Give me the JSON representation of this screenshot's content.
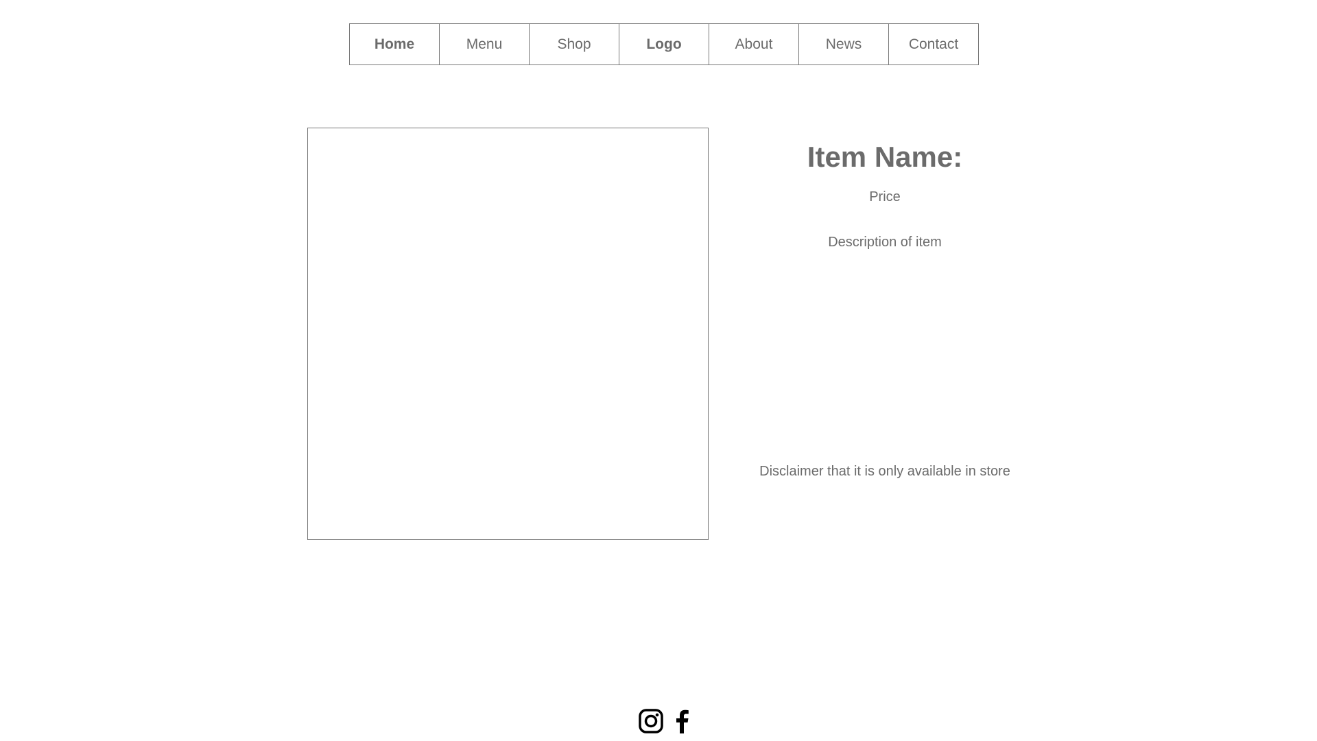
{
  "nav": {
    "items": [
      {
        "label": "Home"
      },
      {
        "label": "Menu"
      },
      {
        "label": "Shop"
      },
      {
        "label": "Logo"
      },
      {
        "label": "About"
      },
      {
        "label": "News"
      },
      {
        "label": "Contact"
      }
    ]
  },
  "product": {
    "title": "Item Name:",
    "price": "Price",
    "description": "Description of item",
    "disclaimer": "Disclaimer that it is only available in store"
  },
  "footer": {
    "social_icons": [
      "instagram-icon",
      "facebook-icon"
    ]
  },
  "colors": {
    "text": "#6b6b6b",
    "border": "#777777",
    "icon": "#000000",
    "background": "#ffffff"
  }
}
